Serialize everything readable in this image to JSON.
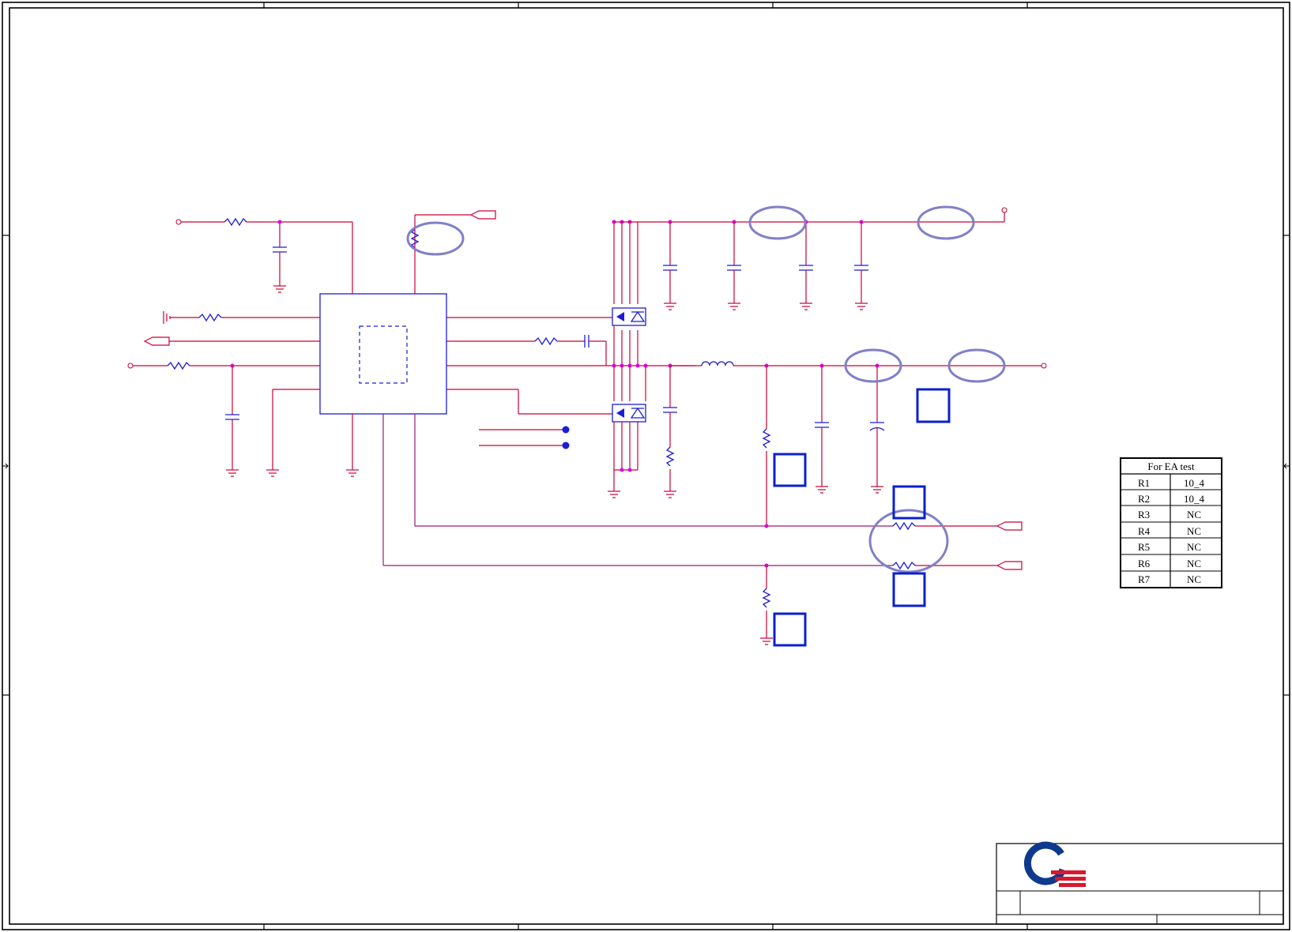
{
  "ea_table": {
    "title": "For EA test",
    "rows": [
      {
        "ref": "R1",
        "value": "10_4"
      },
      {
        "ref": "R2",
        "value": "10_4"
      },
      {
        "ref": "R3",
        "value": "NC"
      },
      {
        "ref": "R4",
        "value": "NC"
      },
      {
        "ref": "R5",
        "value": "NC"
      },
      {
        "ref": "R6",
        "value": "NC"
      },
      {
        "ref": "R7",
        "value": "NC"
      }
    ]
  },
  "colors": {
    "net": "#cc0033",
    "component": "#1c1cd6",
    "junction": "#e000e0",
    "highlight_ring": "#8080c8",
    "marker_box": "#0b1fd0",
    "logo_blue": "#0d3a8c",
    "logo_red": "#d9182d"
  }
}
